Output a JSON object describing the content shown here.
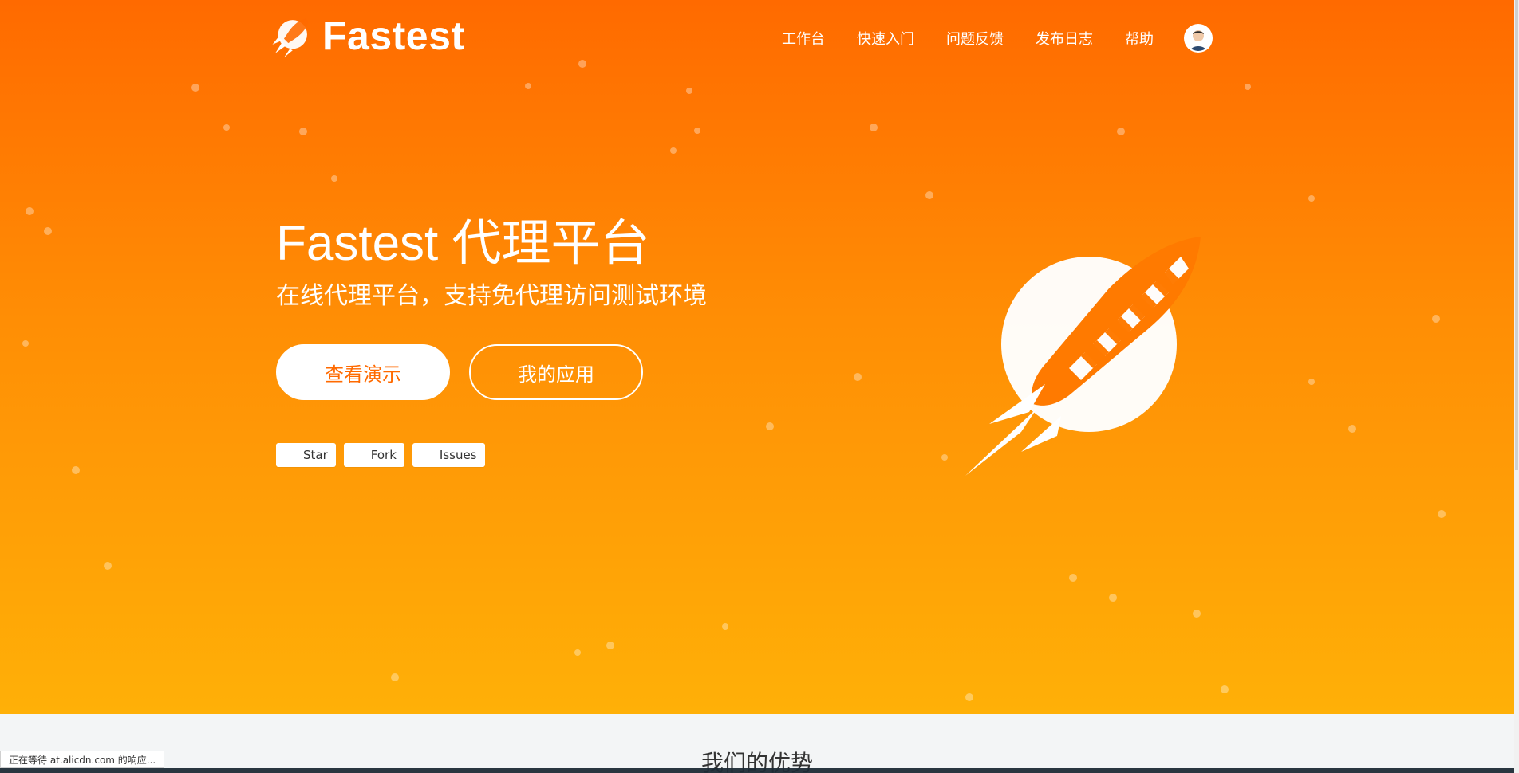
{
  "brand": {
    "name": "Fastest",
    "accent": "#ff6a00"
  },
  "nav": {
    "items": [
      {
        "label": "工作台"
      },
      {
        "label": "快速入门"
      },
      {
        "label": "问题反馈"
      },
      {
        "label": "发布日志"
      },
      {
        "label": "帮助"
      }
    ],
    "avatar_icon": "user-avatar"
  },
  "hero": {
    "title": "Fastest 代理平台",
    "subtitle": "在线代理平台，支持免代理访问测试环境",
    "buttons": {
      "primary": "查看演示",
      "secondary": "我的应用"
    },
    "github": {
      "star": "Star",
      "fork": "Fork",
      "issues": "Issues"
    },
    "art_icon": "rocket-planet-icon"
  },
  "section": {
    "title": "我们的优势"
  },
  "statusbar": {
    "text": "正在等待 at.alicdn.com 的响应..."
  },
  "colors": {
    "hero_top": "#ff6a00",
    "hero_bottom": "#ffb007",
    "white": "#ffffff"
  }
}
